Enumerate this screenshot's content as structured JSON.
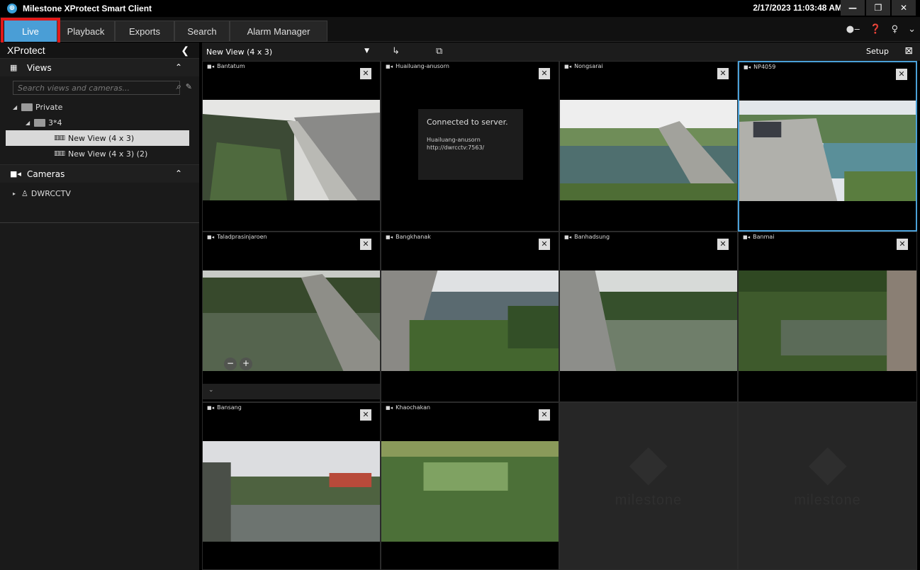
{
  "app": {
    "title": "Milestone XProtect Smart Client",
    "clock": "2/17/2023 11:03:48 AM"
  },
  "window_buttons": {
    "minimize": "—",
    "restore": "❐",
    "close": "✕"
  },
  "tabs": [
    {
      "label": "Live",
      "active": true
    },
    {
      "label": "Playback"
    },
    {
      "label": "Exports"
    },
    {
      "label": "Search"
    },
    {
      "label": "Alarm Manager"
    }
  ],
  "sidebar": {
    "title": "XProtect",
    "views_section": {
      "label": "Views"
    },
    "search_placeholder": "Search views and cameras...",
    "tree": [
      {
        "label": "Private"
      },
      {
        "label": "3*4"
      },
      {
        "label": "New View (4 x 3)",
        "selected": true
      },
      {
        "label": "New View (4 x 3) (2)"
      }
    ],
    "cameras_section": {
      "label": "Cameras"
    },
    "camera_tree": [
      {
        "label": "DWRCCTV"
      }
    ]
  },
  "viewbar": {
    "view_name": "New View (4 x 3)",
    "setup": "Setup"
  },
  "tiles": [
    {
      "name": "Bantatum"
    },
    {
      "name": "Huailuang-anusorn",
      "status_title": "Connected to server.",
      "status_camera": "Huailuang-anusorn",
      "status_url": "http://dwrcctv:7563/"
    },
    {
      "name": "Nongsarai"
    },
    {
      "name": "NP4059"
    },
    {
      "name": "Taladprasinjaroen"
    },
    {
      "name": "Bangkhanak"
    },
    {
      "name": "Banhadsung"
    },
    {
      "name": "Banmai"
    },
    {
      "name": "Bansang"
    },
    {
      "name": "Khaochakan"
    },
    {
      "name": "",
      "empty": true,
      "brand": "milestone"
    },
    {
      "name": "",
      "empty": true,
      "brand": "milestone"
    }
  ],
  "accent_colors": {
    "active_tab": "#4a9ed6",
    "highlight": "#e21a1a",
    "selected_border": "#4aa0d8"
  }
}
